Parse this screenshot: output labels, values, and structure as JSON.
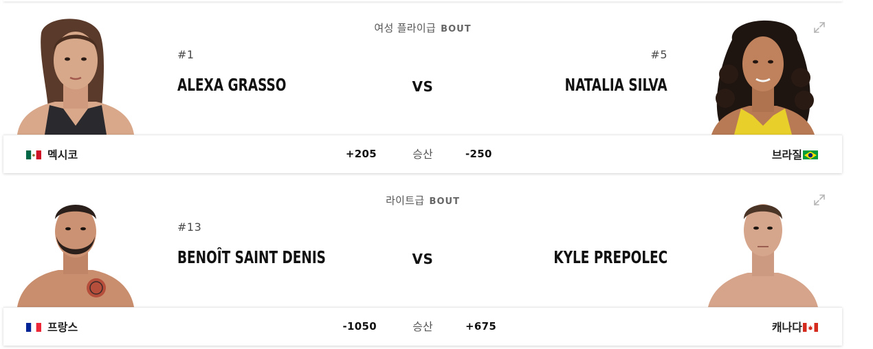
{
  "bouts": [
    {
      "weight_class": "여성 플라이급",
      "bout_word": "BOUT",
      "red": {
        "rank": "#1",
        "name": "ALEXA GRASSO",
        "country": "멕시코",
        "flag": "mexico-flag",
        "odds": "+205"
      },
      "blue": {
        "rank": "#5",
        "name": "NATALIA SILVA",
        "country": "브라질",
        "flag": "brazil-flag",
        "odds": "-250"
      },
      "vs": "VS",
      "odds_label": "승산"
    },
    {
      "weight_class": "라이트급",
      "bout_word": "BOUT",
      "red": {
        "rank": "#13",
        "name": "BENOÎT SAINT DENIS",
        "country": "프랑스",
        "flag": "france-flag",
        "odds": "-1050"
      },
      "blue": {
        "rank": "",
        "name": "KYLE PREPOLEC",
        "country": "캐나다",
        "flag": "canada-flag",
        "odds": "+675"
      },
      "vs": "VS",
      "odds_label": "승산"
    }
  ],
  "icons": {
    "expand": "expand-icon"
  },
  "colors": {
    "text": "#111111",
    "muted": "#555555",
    "card": "#ffffff"
  }
}
